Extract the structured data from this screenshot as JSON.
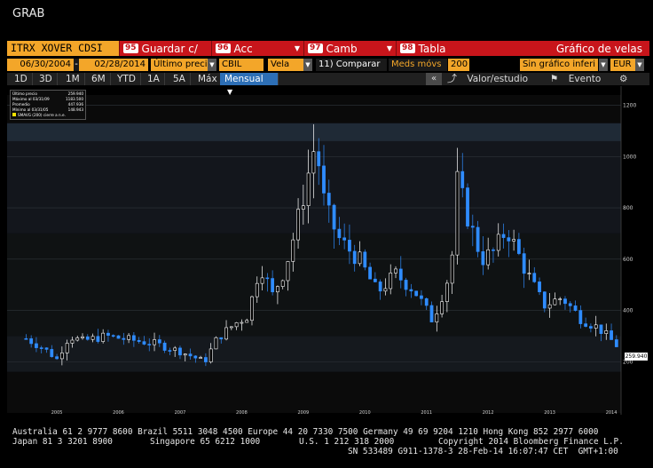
{
  "title": "GRAB",
  "toolbar": {
    "ticker": "ITRX XOVER CDSI",
    "buttons": [
      {
        "num": "95",
        "label": "Guardar c/"
      },
      {
        "num": "96",
        "label": "Acc"
      },
      {
        "num": "97",
        "label": "Camb"
      },
      {
        "num": "98",
        "label": "Tabla"
      }
    ],
    "chart_title": "Gráfico de velas"
  },
  "inputs": {
    "start_date": "06/30/2004",
    "end_date": "02/28/2014",
    "price_type": "Último precio",
    "currency_basis": "CBIL",
    "chart_type": "Vela",
    "compare_label": "11) Comparar",
    "moving_avg_label": "Meds móvs",
    "moving_avg_value": "200",
    "indicator": "Sin gráfico inferi",
    "currency": "EUR"
  },
  "range_tabs": [
    "1D",
    "3D",
    "1M",
    "6M",
    "YTD",
    "1A",
    "5A",
    "Máx"
  ],
  "period_selector": "Mensual",
  "right_tools": {
    "value_study": "Valor/estudio",
    "event": "Evento"
  },
  "legend": [
    {
      "label": "Último precio",
      "value": "259.940"
    },
    {
      "label": "Máximo al 03/31/09",
      "value": "1183.500"
    },
    {
      "label": "Promedio",
      "value": "447.936"
    },
    {
      "label": "Mínimo al 03/31/05",
      "value": "148.943"
    },
    {
      "label": "SMAVG (200) cierre a n.e.",
      "value": ""
    }
  ],
  "last_price_label": "259.940",
  "colors": {
    "up": "#ffffff",
    "down": "#2f8cff",
    "accent_red": "#c8151b",
    "accent_orange": "#f3a629",
    "tab_selected": "#2d6fb6"
  },
  "chart_data": {
    "type": "candlestick",
    "y_ticks": [
      "1200",
      "1000",
      "800",
      "600",
      "400",
      "200"
    ],
    "x_ticks": [
      "2004",
      "2005",
      "2006",
      "2007",
      "2008",
      "2009",
      "2010",
      "2011",
      "2012",
      "2013",
      "2014"
    ],
    "ylim": [
      0,
      1240
    ],
    "anchors": [
      [
        2004.5,
        290
      ],
      [
        2004.8,
        250
      ],
      [
        2005.0,
        210
      ],
      [
        2005.2,
        300
      ],
      [
        2005.4,
        280
      ],
      [
        2005.8,
        300
      ],
      [
        2006.2,
        285
      ],
      [
        2006.6,
        270
      ],
      [
        2007.0,
        240
      ],
      [
        2007.4,
        200
      ],
      [
        2007.6,
        290
      ],
      [
        2007.9,
        350
      ],
      [
        2008.1,
        380
      ],
      [
        2008.3,
        580
      ],
      [
        2008.5,
        460
      ],
      [
        2008.7,
        560
      ],
      [
        2008.9,
        740
      ],
      [
        2009.2,
        1060
      ],
      [
        2009.35,
        800
      ],
      [
        2009.6,
        670
      ],
      [
        2009.9,
        600
      ],
      [
        2010.2,
        470
      ],
      [
        2010.5,
        540
      ],
      [
        2010.8,
        480
      ],
      [
        2011.1,
        360
      ],
      [
        2011.4,
        560
      ],
      [
        2011.5,
        900
      ],
      [
        2011.7,
        740
      ],
      [
        2011.9,
        600
      ],
      [
        2012.1,
        630
      ],
      [
        2012.3,
        720
      ],
      [
        2012.6,
        560
      ],
      [
        2012.9,
        420
      ],
      [
        2013.2,
        450
      ],
      [
        2013.5,
        370
      ],
      [
        2013.8,
        330
      ],
      [
        2014.1,
        260
      ]
    ]
  },
  "footer": {
    "line1": "Australia 61 2 9777 8600 Brazil 5511 3048 4500 Europe 44 20 7330 7500 Germany 49 69 9204 1210 Hong Kong 852 2977 6000",
    "line2a": "Japan 81 3 3201 8900",
    "line2b": "Singapore 65 6212 1000",
    "line2c": "U.S. 1 212 318 2000",
    "line2d": "Copyright 2014 Bloomberg Finance L.P.",
    "line3": "SN 533489 G911-1378-3 28-Feb-14 16:07:47 CET  GMT+1:00"
  }
}
